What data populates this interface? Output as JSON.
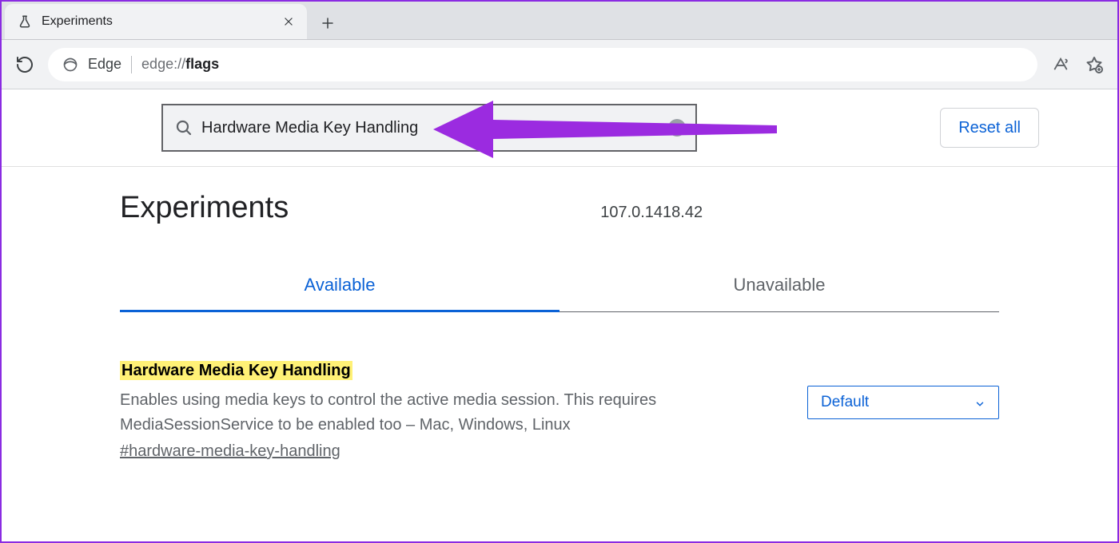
{
  "browser": {
    "tab_title": "Experiments",
    "address_label": "Edge",
    "url_protocol": "edge://",
    "url_path": "flags"
  },
  "page": {
    "search_value": "Hardware Media Key Handling",
    "reset_label": "Reset all",
    "heading": "Experiments",
    "version": "107.0.1418.42",
    "tabs": {
      "available": "Available",
      "unavailable": "Unavailable"
    },
    "flag": {
      "title": "Hardware Media Key Handling",
      "description": "Enables using media keys to control the active media session. This requires MediaSessionService to be enabled too – Mac, Windows, Linux",
      "anchor": "#hardware-media-key-handling",
      "selected_option": "Default"
    }
  }
}
